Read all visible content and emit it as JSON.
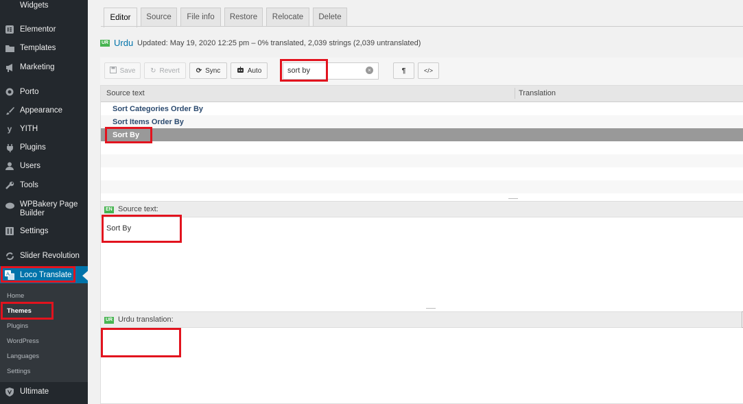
{
  "sidebar": {
    "items": [
      {
        "label": "Widgets",
        "icon": "widgets-icon"
      },
      {
        "label": "Elementor",
        "icon": "elementor-icon"
      },
      {
        "label": "Templates",
        "icon": "folder-icon"
      },
      {
        "label": "Marketing",
        "icon": "megaphone-icon"
      },
      {
        "label": "Porto",
        "icon": "porto-icon"
      },
      {
        "label": "Appearance",
        "icon": "brush-icon"
      },
      {
        "label": "YITH",
        "icon": "yith-icon"
      },
      {
        "label": "Plugins",
        "icon": "plug-icon"
      },
      {
        "label": "Users",
        "icon": "user-icon"
      },
      {
        "label": "Tools",
        "icon": "wrench-icon"
      },
      {
        "label": "WPBakery Page Builder",
        "icon": "wpbakery-icon"
      },
      {
        "label": "Settings",
        "icon": "settings-icon"
      },
      {
        "label": "Slider Revolution",
        "icon": "refresh-icon"
      },
      {
        "label": "Loco Translate",
        "icon": "translate-icon"
      },
      {
        "label": "Ultimate",
        "icon": "shield-icon"
      }
    ],
    "submenu": [
      "Home",
      "Themes",
      "Plugins",
      "WordPress",
      "Languages",
      "Settings"
    ]
  },
  "tabs": [
    "Editor",
    "Source",
    "File info",
    "Restore",
    "Relocate",
    "Delete"
  ],
  "header": {
    "badge": "UR",
    "language": "Urdu",
    "meta": "Updated: May 19, 2020 12:25 pm – 0% translated, 2,039 strings (2,039 untranslated)"
  },
  "toolbar": {
    "save": "Save",
    "revert": "Revert",
    "sync": "Sync",
    "auto": "Auto",
    "search_value": "sort by",
    "pilcrow": "¶",
    "code": "</>"
  },
  "table": {
    "col_source": "Source text",
    "col_translation": "Translation",
    "rows": [
      "Sort Categories Order By",
      "Sort Items Order By",
      "Sort By"
    ]
  },
  "source_panel": {
    "badge": "EN",
    "label": "Source text:",
    "text": "Sort By"
  },
  "translation_panel": {
    "badge": "UR",
    "label": "Urdu translation:",
    "text": ""
  },
  "colors": {
    "sidebar": "#23282d",
    "active": "#0073aa",
    "highlight": "#e2131e",
    "badge": "#46b450"
  }
}
